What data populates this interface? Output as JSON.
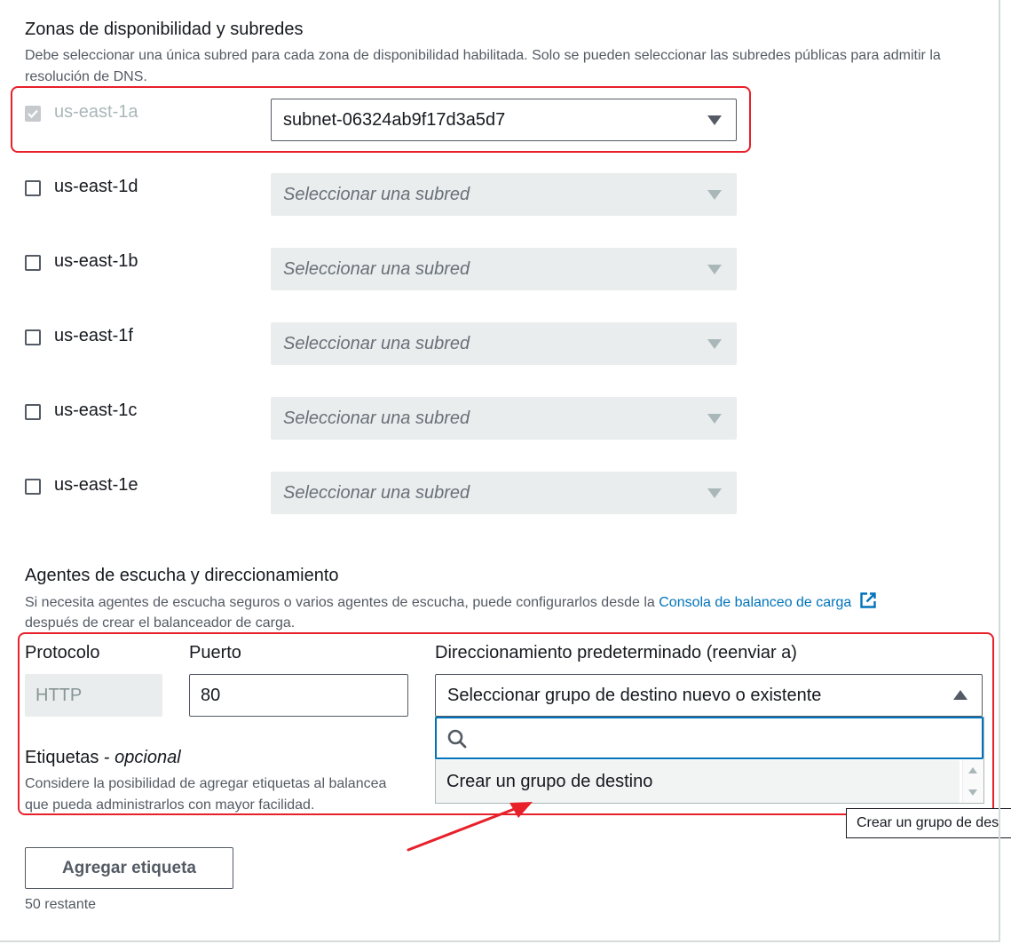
{
  "subnets_section": {
    "title": "Zonas de disponibilidad y subredes",
    "description": "Debe seleccionar una única subred para cada zona de disponibilidad habilitada. Solo se pueden seleccionar las subredes públicas para admitir la resolución de DNS.",
    "zones": [
      {
        "name": "us-east-1a",
        "checked": true,
        "disabled": true,
        "subnet": "subnet-06324ab9f17d3a5d7"
      },
      {
        "name": "us-east-1d",
        "checked": false,
        "subnet_placeholder": "Seleccionar una subred"
      },
      {
        "name": "us-east-1b",
        "checked": false,
        "subnet_placeholder": "Seleccionar una subred"
      },
      {
        "name": "us-east-1f",
        "checked": false,
        "subnet_placeholder": "Seleccionar una subred"
      },
      {
        "name": "us-east-1c",
        "checked": false,
        "subnet_placeholder": "Seleccionar una subred"
      },
      {
        "name": "us-east-1e",
        "checked": false,
        "subnet_placeholder": "Seleccionar una subred"
      }
    ]
  },
  "listeners_section": {
    "title": "Agentes de escucha y direccionamiento",
    "description_before_link": "Si necesita agentes de escucha seguros o varios agentes de escucha, puede configurarlos desde la",
    "link_text": "Consola de balanceo de carga",
    "description_after_link": "después de crear el balanceador de carga.",
    "protocol_label": "Protocolo",
    "protocol_value": "HTTP",
    "port_label": "Puerto",
    "port_value": "80",
    "routing_label": "Direccionamiento predeterminado (reenviar a)",
    "routing_placeholder": "Seleccionar grupo de destino nuevo o existente",
    "dropdown_options": [
      "Crear un grupo de destino"
    ],
    "tooltip": "Crear un grupo de des"
  },
  "tags_section": {
    "title": "Etiquetas - ",
    "title_optional": "opcional",
    "description_line1": "Considere la posibilidad de agregar etiquetas al balancea",
    "description_line2": "que pueda administrarlos con mayor facilidad.",
    "add_button": "Agregar etiqueta",
    "remaining": "50 restante"
  },
  "colors": {
    "annotation_red": "#e8202a",
    "link_blue": "#0073bb"
  }
}
